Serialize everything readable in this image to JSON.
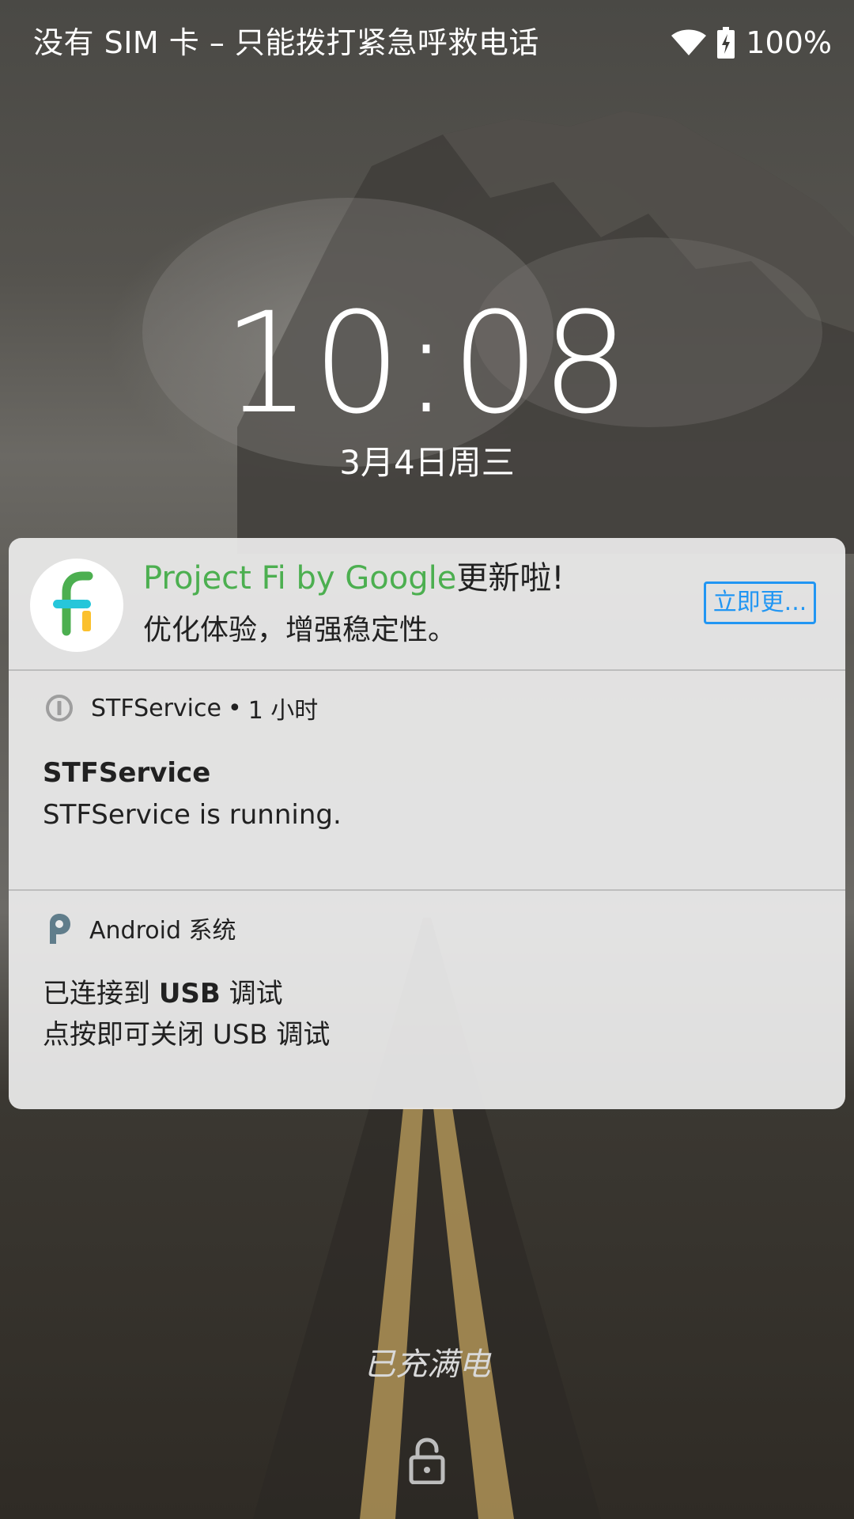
{
  "status_bar": {
    "carrier_text": "没有 SIM 卡 – 只能拨打紧急呼救电话",
    "battery_percent": "100%",
    "wifi_icon": "wifi-icon",
    "battery_icon": "battery-charging-icon"
  },
  "lockscreen": {
    "time": "10:08",
    "date": "3月4日周三",
    "charging_status": "已充满电",
    "lock_icon": "lock-open-icon"
  },
  "notifications": {
    "fi_update": {
      "app_icon": "project-fi-icon",
      "title_app": "Project Fi by Google",
      "title_suffix": "更新啦!",
      "body": "优化体验，增强稳定性。",
      "action_label": "立即更..."
    },
    "stf_service": {
      "app_icon": "info-icon",
      "app_name": "STFService",
      "separator": "•",
      "time_ago": "1 小时",
      "title": "STFService",
      "text": "STFService is running."
    },
    "android_system": {
      "app_icon": "android-p-icon",
      "app_name": "Android 系统",
      "title_prefix": "已连接到 ",
      "title_bold": "USB",
      "title_suffix": " 调试",
      "text": "点按即可关闭 USB 调试"
    }
  },
  "colors": {
    "accent_blue": "#2196f3",
    "fi_green": "#4caf50",
    "panel_bg": "#ececec"
  }
}
